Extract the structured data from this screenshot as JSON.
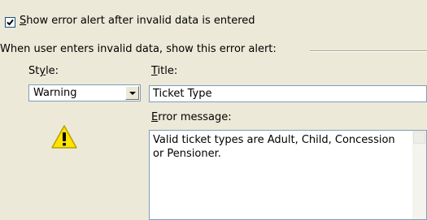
{
  "show_alert_checkbox": {
    "checked": true,
    "label_first": "S",
    "label_rest": "how error alert after invalid data is entered"
  },
  "group_label": "When user enters invalid data, show this error alert:",
  "style": {
    "label_before": "St",
    "label_mnemonic": "y",
    "label_after": "le:",
    "selected": "Warning",
    "icon": "warning-icon"
  },
  "title": {
    "label_mnemonic": "T",
    "label_rest": "itle:",
    "value": "Ticket Type"
  },
  "error_message": {
    "label_mnemonic": "E",
    "label_rest": "rror message:",
    "value": "Valid ticket types are Adult, Child, Concession\nor Pensioner."
  },
  "colors": {
    "dialog_bg": "#ece9d8",
    "field_border": "#7f9db9",
    "warning_fill": "#ffe400"
  }
}
